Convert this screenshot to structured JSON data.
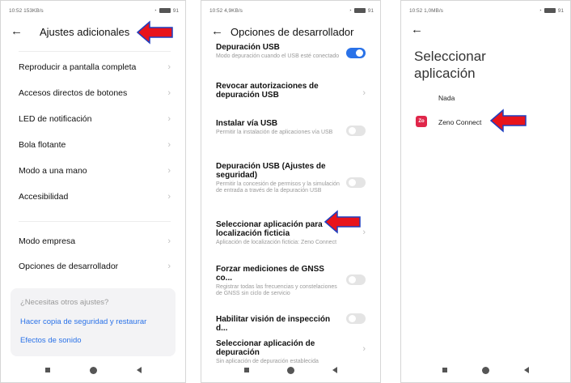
{
  "panel1": {
    "status_time": "10:52",
    "status_speed": "153KB/s",
    "status_right": "91",
    "title": "Ajustes adicionales",
    "items": [
      {
        "label": "Reproducir a pantalla completa"
      },
      {
        "label": "Accesos directos de botones"
      },
      {
        "label": "LED de notificación"
      },
      {
        "label": "Bola flotante"
      },
      {
        "label": "Modo a una mano"
      },
      {
        "label": "Accesibilidad"
      }
    ],
    "items2": [
      {
        "label": "Modo empresa"
      },
      {
        "label": "Opciones de desarrollador"
      }
    ],
    "card": {
      "question": "¿Necesitas otros ajustes?",
      "link1": "Hacer copia de seguridad y restaurar",
      "link2": "Efectos de sonido"
    }
  },
  "panel2": {
    "status_time": "10:52",
    "status_speed": "4,9KB/s",
    "status_right": "91",
    "title": "Opciones de desarrollador",
    "items": [
      {
        "title": "Depuración USB",
        "sub": "Modo depuración cuando el USB esté conectado",
        "control": "toggle-on"
      },
      {
        "title": "Revocar autorizaciones de depuración USB",
        "sub": "",
        "control": "chevron"
      },
      {
        "title": "Instalar vía USB",
        "sub": "Permitir la instalación de aplicaciones vía USB",
        "control": "toggle-off"
      },
      {
        "title": "Depuración USB (Ajustes de seguridad)",
        "sub": "Permitir la concesión de permisos y la simulación de entrada a través de la depuración USB",
        "control": "toggle-off"
      },
      {
        "title": "Seleccionar aplicación para localización ficticia",
        "sub": "Aplicación de localización ficticia: Zeno Connect",
        "control": "chevron"
      },
      {
        "title": "Forzar mediciones de GNSS co...",
        "sub": "Registrar todas las frecuencias y constelaciones de GNSS sin ciclo de servicio",
        "control": "toggle-off"
      },
      {
        "title": "Habilitar visión de inspección d...",
        "sub": "",
        "control": "toggle-off"
      },
      {
        "title": "Seleccionar aplicación de depuración",
        "sub": "Sin aplicación de depuración establecida",
        "control": "chevron"
      }
    ]
  },
  "panel3": {
    "status_time": "10:52",
    "status_speed": "1,0MB/s",
    "status_right": "91",
    "title_line1": "Seleccionar",
    "title_line2": "aplicación",
    "option_none": "Nada",
    "option_app": "Zeno Connect",
    "app_icon_text": "Zo"
  },
  "colors": {
    "accent": "#2a72e8",
    "arrow_fill": "#e8141b",
    "arrow_border": "#1f3fbf"
  },
  "icons": {
    "back": "arrow-left-icon",
    "chevron": "chevron-right-icon"
  }
}
